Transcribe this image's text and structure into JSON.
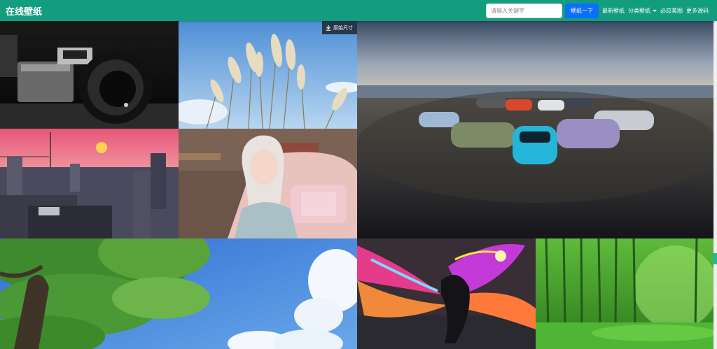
{
  "navbar": {
    "brand": "在线壁纸",
    "search": {
      "placeholder": "请输入关键字",
      "button": "壁纸一下"
    },
    "links": [
      {
        "label": "最新壁纸"
      },
      {
        "label": "分类壁纸",
        "dropdown": true
      },
      {
        "label": "必应美图"
      },
      {
        "label": "更多源码"
      }
    ]
  },
  "gallery": {
    "download_label": "原始尺寸",
    "icons": [
      "download-icon",
      "caret-down-icon"
    ]
  },
  "colors": {
    "navbar": "#139d7f",
    "search_button": "#0d6efd",
    "badge_bg": "#1e2832",
    "scroll_thumb": "#1abc9c"
  }
}
